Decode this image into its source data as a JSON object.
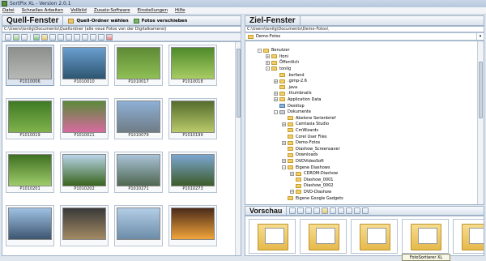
{
  "window": {
    "title": "SortPix XL - Version 2.0.1"
  },
  "menu": [
    "Datei",
    "Schnelles Arbeiten",
    "Vollbild",
    "Zusatz-Software",
    "Einstellungen",
    "Hilfe"
  ],
  "left": {
    "title": "Quell-Fenster",
    "btn_source": "Quell-Ordner wählen",
    "btn_move": "Fotos verschieben",
    "path": "C:\\Users\\tonilg\\Documents\\Quellordner (alle neue Fotos von der Digitalkamera\\)",
    "thumbs": [
      {
        "name": "P1010006",
        "colors": [
          "#8d8f8c",
          "#b7b9b6"
        ]
      },
      {
        "name": "P1010010",
        "colors": [
          "#6a9fd0",
          "#2d5570"
        ]
      },
      {
        "name": "P1010017",
        "colors": [
          "#5d8a34",
          "#8fbf55"
        ]
      },
      {
        "name": "P1010018",
        "colors": [
          "#4e8a2a",
          "#a8cc63"
        ]
      },
      {
        "name": "P1010019",
        "colors": [
          "#3f7a24",
          "#7fb24c"
        ]
      },
      {
        "name": "P1010021",
        "colors": [
          "#5b8a3a",
          "#d86aa0"
        ]
      },
      {
        "name": "P1010079",
        "colors": [
          "#8eb0d6",
          "#6f7c86"
        ]
      },
      {
        "name": "P1010199",
        "colors": [
          "#556d2e",
          "#b9c96a"
        ]
      },
      {
        "name": "P1010201",
        "colors": [
          "#3e7022",
          "#9ecb6a"
        ]
      },
      {
        "name": "P1010202",
        "colors": [
          "#b9d4e9",
          "#38641d"
        ]
      },
      {
        "name": "P1010271",
        "colors": [
          "#a9c3d9",
          "#4f6750"
        ]
      },
      {
        "name": "P1010273",
        "colors": [
          "#7ba6d1",
          "#3d5c2a"
        ]
      },
      {
        "name": "",
        "colors": [
          "#9fc1e4",
          "#3d5670"
        ]
      },
      {
        "name": "",
        "colors": [
          "#3a3a3a",
          "#a28a62"
        ]
      },
      {
        "name": "",
        "colors": [
          "#b3cde6",
          "#6c8ca8"
        ]
      },
      {
        "name": "",
        "colors": [
          "#4a2a1a",
          "#f2a53a"
        ]
      }
    ]
  },
  "right": {
    "title": "Ziel-Fenster",
    "path": "C:\\Users\\tonilg\\Documents\\Demo-Fotos\\",
    "dropdown": "Demo-Fotos",
    "tree": [
      {
        "label": "Benutzer",
        "level": 0,
        "exp": "-",
        "kind": "yellow"
      },
      {
        "label": "Itoni",
        "level": 1,
        "exp": "+",
        "kind": "yellow"
      },
      {
        "label": "Öffentlich",
        "level": 1,
        "exp": "+",
        "kind": "yellow"
      },
      {
        "label": "tonilg",
        "level": 1,
        "exp": "-",
        "kind": "yellow"
      },
      {
        "label": ".bsrfand",
        "level": 2,
        "exp": "",
        "kind": "yellow"
      },
      {
        "label": ".gimp-2.6",
        "level": 2,
        "exp": "+",
        "kind": "yellow"
      },
      {
        "label": ".java",
        "level": 2,
        "exp": "",
        "kind": "yellow"
      },
      {
        "label": ".thumbnails",
        "level": 2,
        "exp": "+",
        "kind": "yellow"
      },
      {
        "label": "Application Data",
        "level": 2,
        "exp": "+",
        "kind": "yellow"
      },
      {
        "label": "Desktop",
        "level": 2,
        "exp": "",
        "kind": "blue"
      },
      {
        "label": "Dokumente",
        "level": 2,
        "exp": "-",
        "kind": "gray"
      },
      {
        "label": "Abelone Serienbrief",
        "level": 3,
        "exp": "",
        "kind": "yellow"
      },
      {
        "label": "Camtasia Studio",
        "level": 3,
        "exp": "+",
        "kind": "yellow"
      },
      {
        "label": "CmWizards",
        "level": 3,
        "exp": "",
        "kind": "yellow"
      },
      {
        "label": "Corel User Files",
        "level": 3,
        "exp": "",
        "kind": "yellow"
      },
      {
        "label": "Demo-Fotos",
        "level": 3,
        "exp": "+",
        "kind": "yellow"
      },
      {
        "label": "Diashow_Screensaver",
        "level": 3,
        "exp": "",
        "kind": "yellow"
      },
      {
        "label": "Downloads",
        "level": 3,
        "exp": "",
        "kind": "yellow"
      },
      {
        "label": "DVDVideoSoft",
        "level": 3,
        "exp": "+",
        "kind": "yellow"
      },
      {
        "label": "Eigene Diashows",
        "level": 3,
        "exp": "-",
        "kind": "yellow"
      },
      {
        "label": "CDROM-Diashow",
        "level": 4,
        "exp": "+",
        "kind": "yellow"
      },
      {
        "label": "Diashow_0001",
        "level": 4,
        "exp": "",
        "kind": "yellow"
      },
      {
        "label": "Diashow_0002",
        "level": 4,
        "exp": "",
        "kind": "yellow"
      },
      {
        "label": "DVD-Diashow",
        "level": 4,
        "exp": "+",
        "kind": "yellow"
      },
      {
        "label": "Eigene Google Gadgets",
        "level": 3,
        "exp": "",
        "kind": "yellow"
      }
    ]
  },
  "preview": {
    "title": "Vorschau",
    "items": 5
  },
  "taskbar_tooltip": "FotoSortierer XL"
}
